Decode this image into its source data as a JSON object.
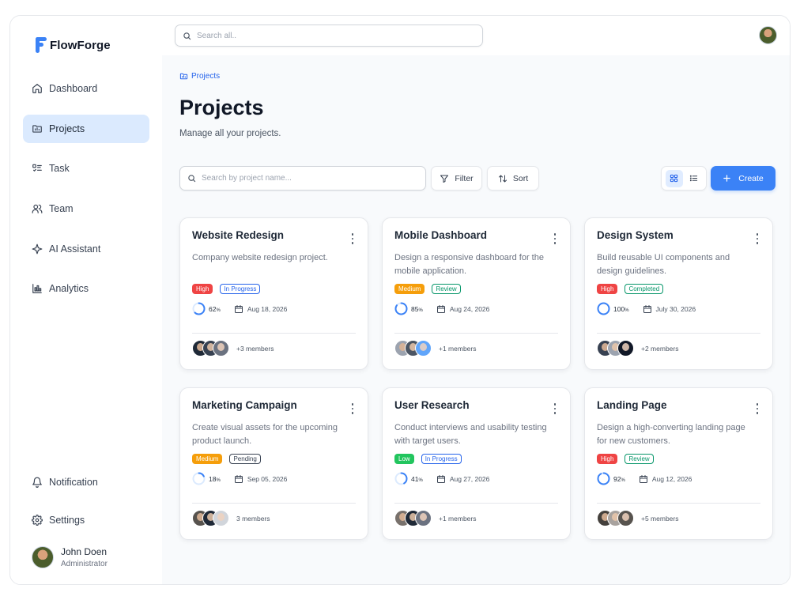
{
  "app": {
    "name": "FlowForge",
    "accent": "#3b82f6"
  },
  "sidebar": {
    "items": [
      {
        "label": "Dashboard",
        "icon": "home-icon"
      },
      {
        "label": "Projects",
        "icon": "folder-icon",
        "active": true
      },
      {
        "label": "Task",
        "icon": "checklist-icon"
      },
      {
        "label": "Team",
        "icon": "users-icon"
      },
      {
        "label": "AI Assistant",
        "icon": "sparkle-icon"
      },
      {
        "label": "Analytics",
        "icon": "bar-chart-icon"
      }
    ],
    "bottom_items": [
      {
        "label": "Notification",
        "icon": "bell-icon"
      },
      {
        "label": "Settings",
        "icon": "gear-icon"
      }
    ],
    "user": {
      "name": "John Doen",
      "role": "Administrator"
    }
  },
  "topbar": {
    "search_placeholder": "Search all.."
  },
  "main": {
    "breadcrumb": "Projects",
    "title": "Projects",
    "subtitle": "Manage all your projects.",
    "search_placeholder": "Search by project name...",
    "filter_label": "Filter",
    "sort_label": "Sort",
    "create_label": "Create",
    "view_mode": "grid"
  },
  "projects": [
    {
      "title": "Website Redesign",
      "description": "Company website redesign project.",
      "priority": "High",
      "priority_color": "#ef4444",
      "status": "In Progress",
      "status_color": "#2563eb",
      "progress": 62,
      "due": "Aug 18, 2026",
      "members": "+3 members"
    },
    {
      "title": "Mobile Dashboard",
      "description": "Design a responsive dashboard for the mobile application.",
      "priority": "Medium",
      "priority_color": "#f59e0b",
      "status": "Review",
      "status_color": "#059669",
      "progress": 85,
      "due": "Aug 24, 2026",
      "members": "+1 members"
    },
    {
      "title": "Design System",
      "description": "Build reusable UI components and design guidelines.",
      "priority": "High",
      "priority_color": "#ef4444",
      "status": "Completed",
      "status_color": "#059669",
      "progress": 100,
      "due": "July 30, 2026",
      "members": "+2 members"
    },
    {
      "title": "Marketing Campaign",
      "description": "Create visual assets for the upcoming product launch.",
      "priority": "Medium",
      "priority_color": "#f59e0b",
      "status": "Pending",
      "status_color": "#374151",
      "progress": 18,
      "due": "Sep 05, 2026",
      "members": "3 members"
    },
    {
      "title": "User Research",
      "description": "Conduct interviews and usability testing with target users.",
      "priority": "Low",
      "priority_color": "#22c55e",
      "status": "In Progress",
      "status_color": "#2563eb",
      "progress": 41,
      "due": "Aug 27, 2026",
      "members": "+1 members"
    },
    {
      "title": "Landing Page",
      "description": "Design a high-converting landing page for new customers.",
      "priority": "High",
      "priority_color": "#ef4444",
      "status": "Review",
      "status_color": "#059669",
      "progress": 92,
      "due": "Aug 12, 2026",
      "members": "+5 members"
    }
  ]
}
